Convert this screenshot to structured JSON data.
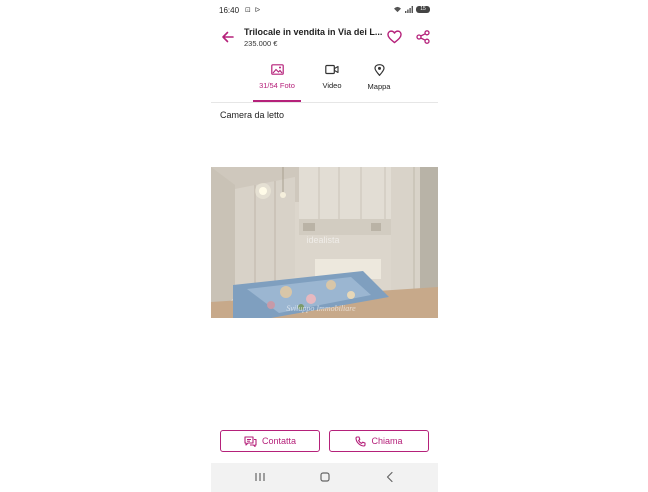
{
  "status_bar": {
    "time": "16:40",
    "icons_left": "⊡ ᐅ",
    "battery": "15"
  },
  "header": {
    "title": "Trilocale in vendita in Via dei L...",
    "price": "235.000 €",
    "accent_color": "#b5217a"
  },
  "tabs": [
    {
      "label": "31/54 Foto",
      "icon": "image-icon",
      "active": true
    },
    {
      "label": "Video",
      "icon": "video-icon",
      "active": false
    },
    {
      "label": "Mappa",
      "icon": "map-pin-icon",
      "active": false
    }
  ],
  "photo": {
    "caption": "Camera da letto",
    "watermark_top": "idealista",
    "watermark_bottom": "Sviluppo Immobiliare"
  },
  "actions": {
    "contatta": "Contatta",
    "chiama": "Chiama"
  },
  "nav": {
    "recent": "recent-apps-icon",
    "home": "home-icon",
    "back": "back-icon"
  }
}
